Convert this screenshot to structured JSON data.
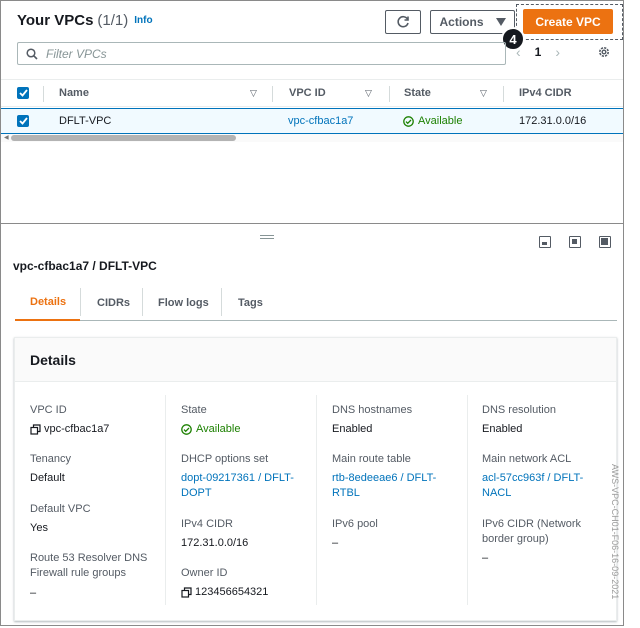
{
  "header": {
    "title": "Your VPCs",
    "count": "(1/1)",
    "info": "Info",
    "actions_label": "Actions",
    "create_label": "Create VPC",
    "step_badge": "4"
  },
  "filter": {
    "placeholder": "Filter VPCs"
  },
  "pagination": {
    "page": "1"
  },
  "table": {
    "columns": [
      "Name",
      "VPC ID",
      "State",
      "IPv4 CIDR"
    ],
    "rows": [
      {
        "selected": true,
        "name": "DFLT-VPC",
        "vpc_id": "vpc-cfbac1a7",
        "state": "Available",
        "ipv4_cidr": "172.31.0.0/16"
      }
    ]
  },
  "details": {
    "heading": "vpc-cfbac1a7 / DFLT-VPC",
    "tabs": [
      "Details",
      "CIDRs",
      "Flow logs",
      "Tags"
    ],
    "active_tab": "Details",
    "card_title": "Details",
    "col1": [
      {
        "label": "VPC ID",
        "value": "vpc-cfbac1a7"
      },
      {
        "label": "Tenancy",
        "value": "Default"
      },
      {
        "label": "Default VPC",
        "value": "Yes"
      },
      {
        "label": "Route 53 Resolver DNS Firewall rule groups",
        "value": "–"
      }
    ],
    "col2": [
      {
        "label": "State",
        "value": "Available"
      },
      {
        "label": "DHCP options set",
        "value": "dopt-09217361 / DFLT-DOPT"
      },
      {
        "label": "IPv4 CIDR",
        "value": "172.31.0.0/16"
      },
      {
        "label": "Owner ID",
        "value": "123456654321"
      }
    ],
    "col3": [
      {
        "label": "DNS hostnames",
        "value": "Enabled"
      },
      {
        "label": "Main route table",
        "value": "rtb-8edeeae6 / DFLT-RTBL"
      },
      {
        "label": "IPv6 pool",
        "value": "–"
      }
    ],
    "col4": [
      {
        "label": "DNS resolution",
        "value": "Enabled"
      },
      {
        "label": "Main network ACL",
        "value": "acl-57cc963f / DFLT-NACL"
      },
      {
        "label": "IPv6 CIDR (Network border group)",
        "value": "–"
      }
    ]
  },
  "caption": "AWS-VPC-CH01-F06-16-09-2021",
  "colors": {
    "accent": "#ec7211",
    "link": "#0073bb",
    "success": "#1d8102"
  }
}
